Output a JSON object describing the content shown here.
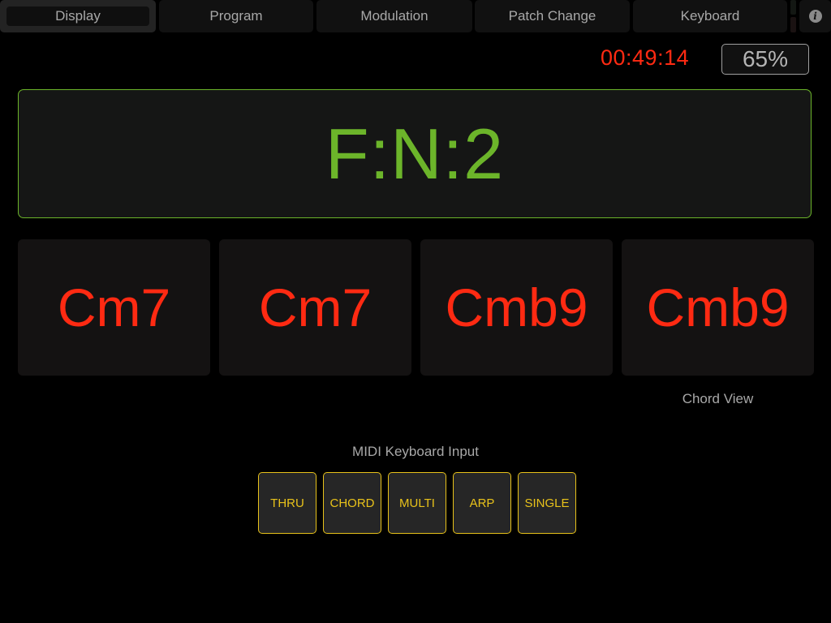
{
  "tabs": [
    {
      "label": "Display",
      "active": true
    },
    {
      "label": "Program",
      "active": false
    },
    {
      "label": "Modulation",
      "active": false
    },
    {
      "label": "Patch Change",
      "active": false
    },
    {
      "label": "Keyboard",
      "active": false
    }
  ],
  "info_icon": "info-icon",
  "status": {
    "timer": "00:49:14",
    "percent": "65%"
  },
  "main_display": {
    "text": "F:N:2",
    "color": "#6cb52a"
  },
  "chords": [
    {
      "label": "Cm7"
    },
    {
      "label": "Cm7"
    },
    {
      "label": "Cmb9"
    },
    {
      "label": "Cmb9"
    }
  ],
  "chord_view_label": "Chord View",
  "midi_input": {
    "label": "MIDI Keyboard Input",
    "modes": [
      {
        "label": "THRU"
      },
      {
        "label": "CHORD"
      },
      {
        "label": "MULTI"
      },
      {
        "label": "ARP"
      },
      {
        "label": "SINGLE"
      }
    ]
  },
  "colors": {
    "accent_green": "#6cb52a",
    "chord_red": "#ff2a12",
    "mode_yellow": "#e8c21a"
  }
}
